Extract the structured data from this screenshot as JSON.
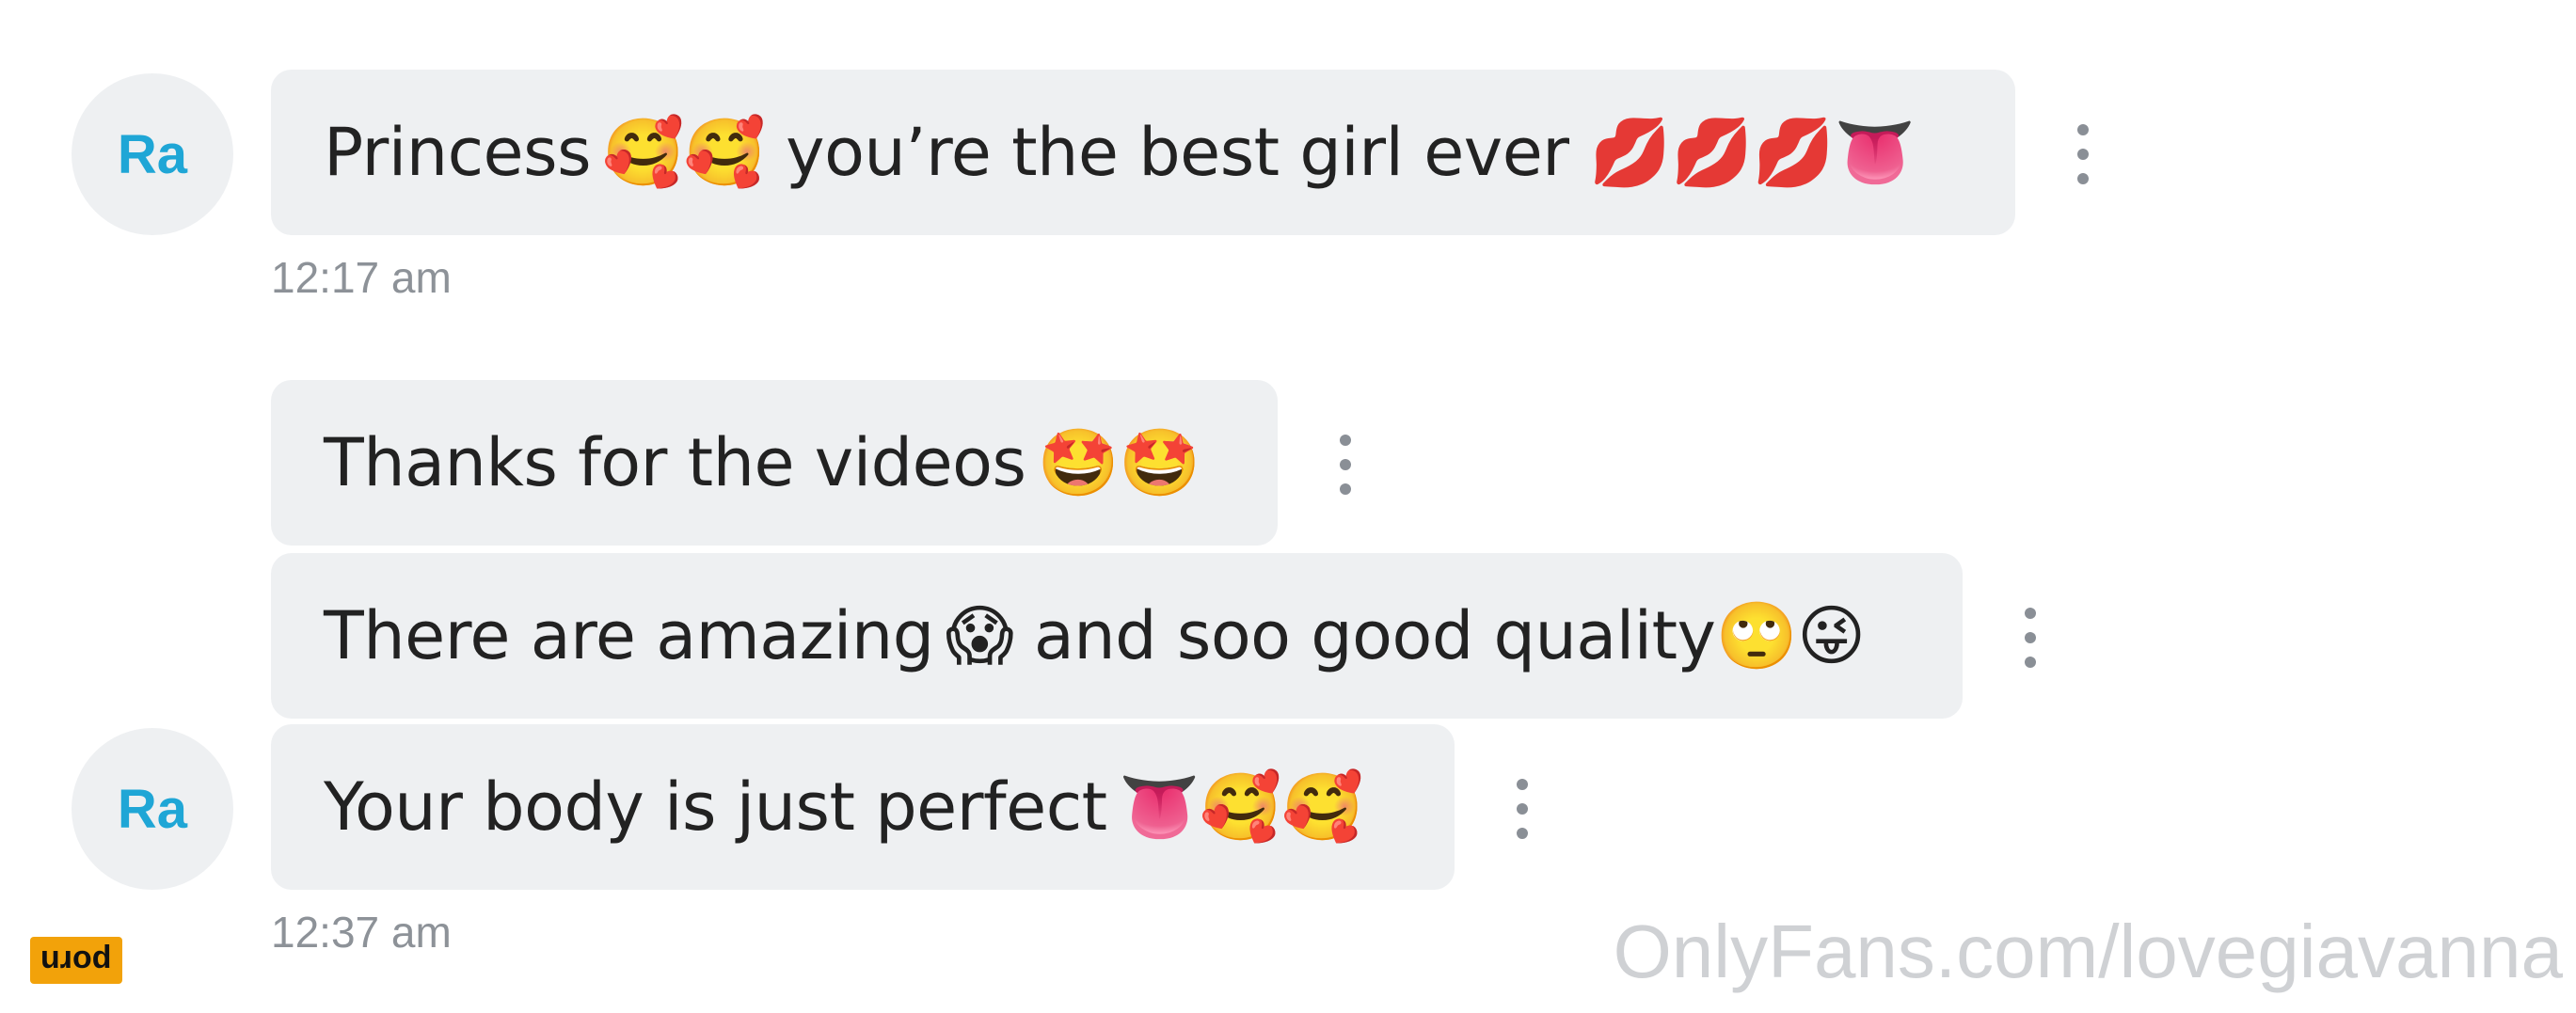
{
  "messages": [
    {
      "avatar": "Ra",
      "text": "Princess",
      "emoji": "🥰🥰 you’re the best girl ever 💋💋💋👅",
      "time": "12:17 am"
    },
    {
      "text": "Thanks for the videos",
      "emoji": "🤩🤩"
    },
    {
      "text": "There are amazing",
      "emoji": "😱 and soo good quality🙄😜"
    },
    {
      "avatar": "Ra",
      "text": "Your body is just perfect",
      "emoji": "👅🥰🥰",
      "time": "12:37 am"
    }
  ],
  "watermark": "OnlyFans.com/lovegiavanna",
  "badge": "porn",
  "colors": {
    "avatar_text": "#1fa6d6",
    "bubble_bg": "#eef0f2",
    "time_text": "#8d9298",
    "watermark": "#cfd1d4",
    "badge_bg": "#f2a20a"
  },
  "icons": {
    "message_menu": "more-vertical-icon"
  }
}
